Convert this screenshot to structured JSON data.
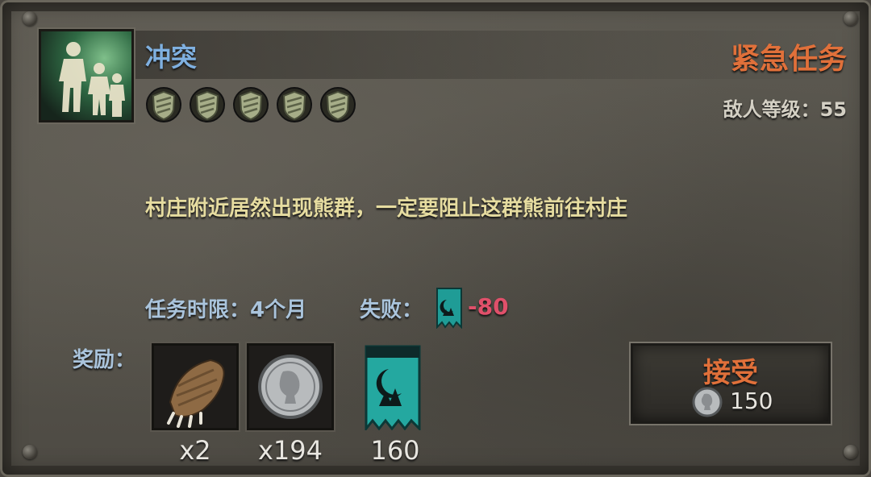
{
  "mission": {
    "name": "冲突",
    "type_label": "紧急任务",
    "enemy_level_label": "敌人等级：",
    "enemy_level": "55",
    "difficulty": 5,
    "description": "村庄附近居然出现熊群，一定要阻止这群熊前往村庄",
    "time_limit_label": "任务时限：",
    "time_limit": "4个月",
    "fail_label": "失败：",
    "fail_penalty": "-80"
  },
  "rewards": {
    "label": "奖励：",
    "items": [
      {
        "icon": "bear-claw-icon",
        "count": "x2"
      },
      {
        "icon": "silver-coin-icon",
        "count": "x194"
      },
      {
        "icon": "faction-banner-icon",
        "count": "160"
      }
    ]
  },
  "accept": {
    "label": "接受",
    "cost": "150",
    "cost_icon": "silver-coin-icon"
  },
  "colors": {
    "urgent": "#e0703a",
    "title": "#7fb0e0",
    "description": "#e6dca0",
    "penalty": "#e0506a"
  }
}
